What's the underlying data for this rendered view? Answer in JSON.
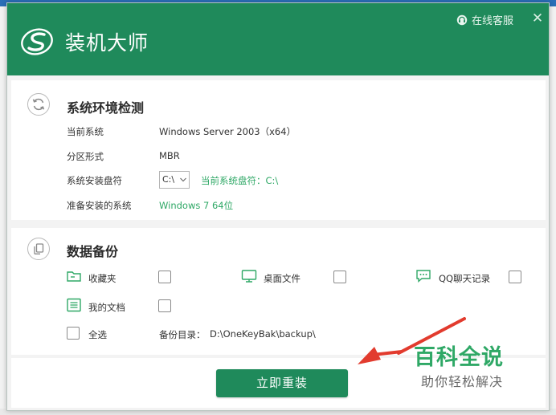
{
  "window": {
    "title": "装机大师",
    "support_label": "在线客服",
    "close_glyph": "✕"
  },
  "env": {
    "section_title": "系统环境检测",
    "current_system_label": "当前系统",
    "current_system_value": "Windows Server 2003（x64）",
    "partition_label": "分区形式",
    "partition_value": "MBR",
    "install_drive_label": "系统安装盘符",
    "install_drive_selected": "C:\\",
    "current_drive_text": "当前系统盘符：C:\\",
    "target_system_label": "准备安装的系统",
    "target_system_value": "Windows 7 64位"
  },
  "backup": {
    "section_title": "数据备份",
    "items": [
      {
        "label": "收藏夹",
        "icon": "folder-icon",
        "checked": false
      },
      {
        "label": "桌面文件",
        "icon": "monitor-icon",
        "checked": false
      },
      {
        "label": "QQ聊天记录",
        "icon": "chat-icon",
        "checked": false
      },
      {
        "label": "我的文档",
        "icon": "document-icon",
        "checked": false
      }
    ],
    "select_all_label": "全选",
    "select_all_checked": false,
    "backup_dir_label": "备份目录：",
    "backup_dir_value": "D:\\OneKeyBak\\backup\\"
  },
  "action": {
    "install_label": "立即重装"
  },
  "watermark": {
    "title": "百科全说",
    "subtitle": "助你轻松解决"
  },
  "colors": {
    "brand_green": "#1f8a5b",
    "accent_green": "#2fa866",
    "watermark_arrow": "#e23b2e"
  }
}
